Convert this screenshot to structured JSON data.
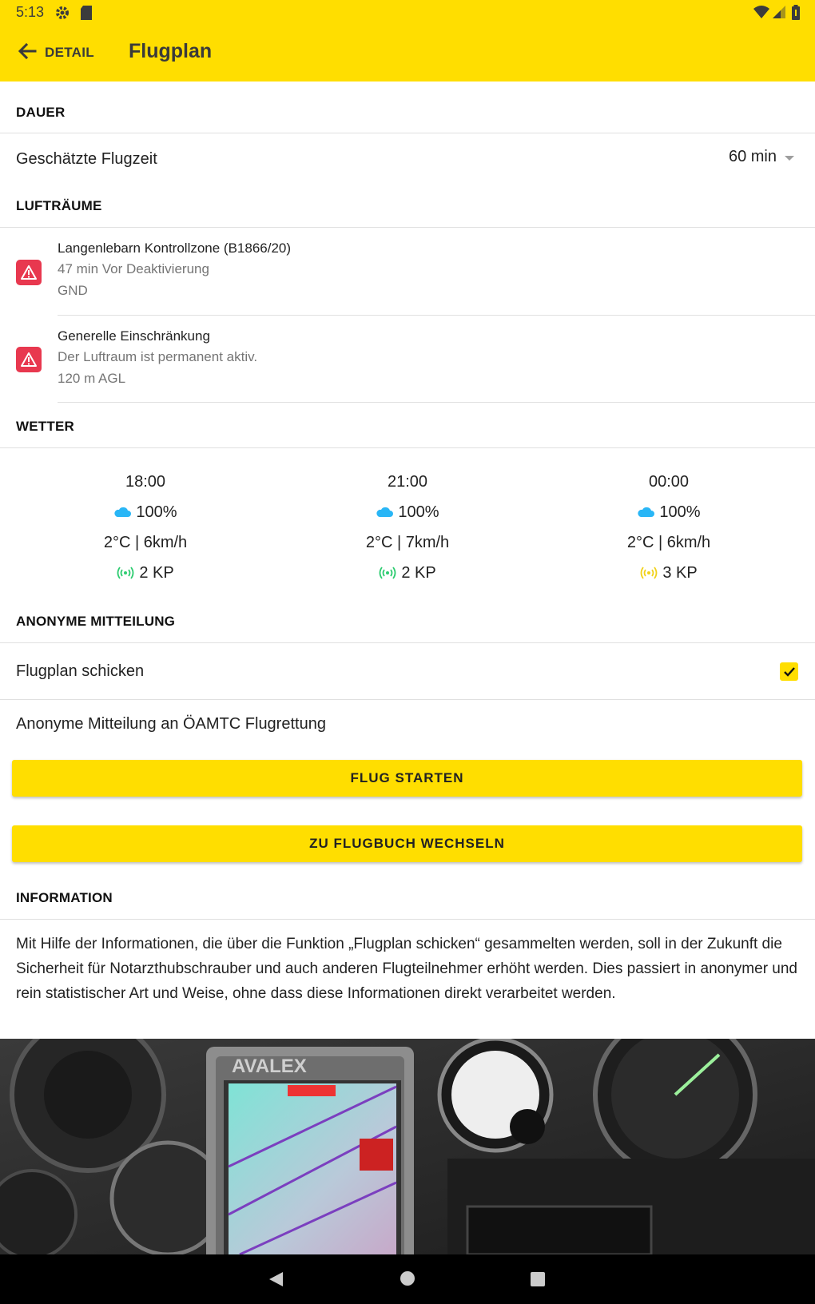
{
  "status_bar": {
    "time": "5:13",
    "icons": [
      "gear-icon",
      "sd-card-icon",
      "wifi-icon",
      "signal-icon",
      "battery-icon"
    ]
  },
  "toolbar": {
    "back_label": "DETAIL",
    "title": "Flugplan",
    "background": "#FFDE00"
  },
  "dauer": {
    "header": "DAUER",
    "estimated_label": "Geschätzte Flugzeit",
    "estimated_value": "60 min"
  },
  "luftraeume": {
    "header": "LUFTRÄUME",
    "items": [
      {
        "title": "Langenlebarn Kontrollzone (B1866/20)",
        "line1": "47 min Vor Deaktivierung",
        "line2": "GND"
      },
      {
        "title": "Generelle Einschränkung",
        "line1": "Der Luftraum ist permanent aktiv.",
        "line2": "120 m AGL"
      }
    ]
  },
  "wetter": {
    "header": "WETTER",
    "columns": [
      {
        "time": "18:00",
        "cloud": "100%",
        "temp_wind": "2°C | 6km/h",
        "kp": "2 KP",
        "kp_color": "#2ecc71"
      },
      {
        "time": "21:00",
        "cloud": "100%",
        "temp_wind": "2°C | 7km/h",
        "kp": "2 KP",
        "kp_color": "#2ecc71"
      },
      {
        "time": "00:00",
        "cloud": "100%",
        "temp_wind": "2°C | 6km/h",
        "kp": "3 KP",
        "kp_color": "#f1d21b"
      }
    ]
  },
  "mitteilung": {
    "header": "ANONYME MITTEILUNG",
    "send_label": "Flugplan schicken",
    "send_checked": true,
    "note": "Anonyme Mitteilung an ÖAMTC Flugrettung"
  },
  "buttons": {
    "start": "FLUG STARTEN",
    "logbook": "ZU FLUGBUCH WECHSELN"
  },
  "information": {
    "header": "INFORMATION",
    "text": "Mit Hilfe der Informationen, die über die Funktion „Flugplan schicken“ gesammelten werden, soll in der Zukunft die Sicherheit für Notarzthubschrauber und auch anderen Flugteilnehmer erhöht werden. Dies passiert in anonymer und rein statistischer Art und Weise, ohne dass diese Informationen direkt verarbeitet werden."
  },
  "photo": {
    "brand_text": "AVALEX"
  }
}
